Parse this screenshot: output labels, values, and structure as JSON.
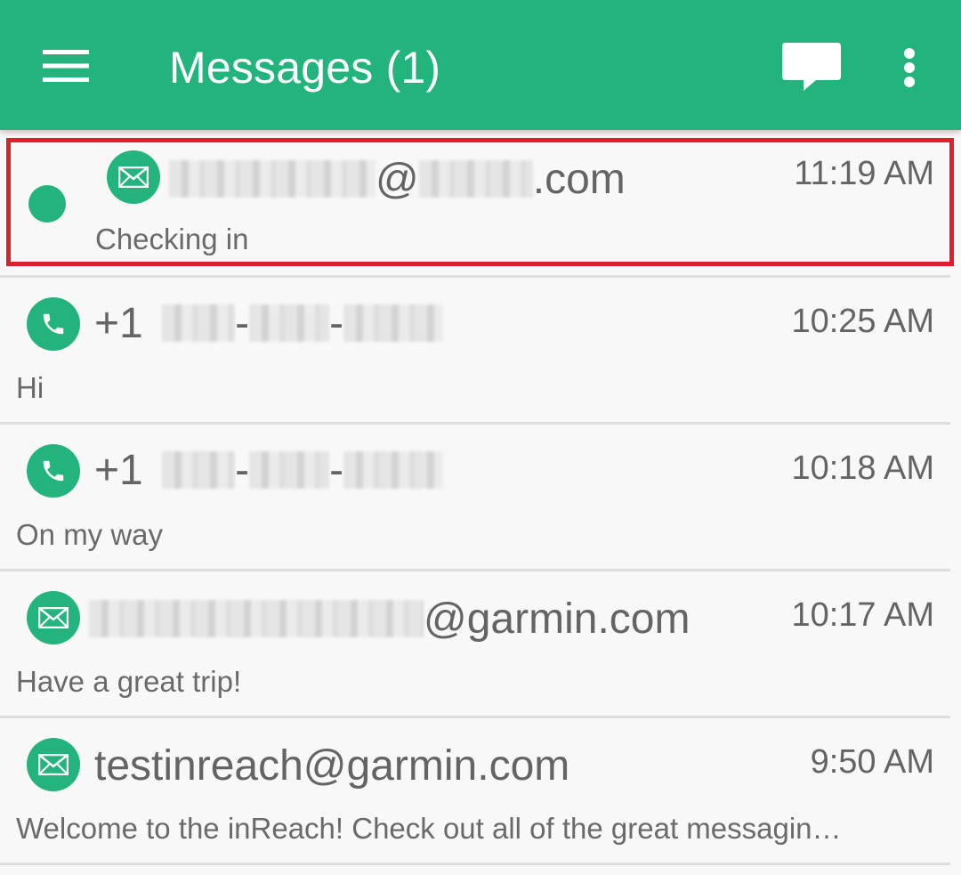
{
  "app_bar": {
    "title": "Messages (1)",
    "menu_icon": "hamburger-menu-icon",
    "compose_icon": "chat-bubble-icon",
    "overflow_icon": "more-vert-icon",
    "background_color": "#22b47c"
  },
  "messages": [
    {
      "type_icon": "email-icon",
      "sender_prefix": "",
      "sender_middle": "@",
      "sender_suffix": ".com",
      "time": "11:19 AM",
      "preview": "Checking in",
      "unread": true,
      "selected": true
    },
    {
      "type_icon": "phone-icon",
      "sender_prefix": "+1",
      "sender_middle": "-",
      "sender_middle2": "-",
      "time": "10:25 AM",
      "preview": "Hi",
      "unread": false
    },
    {
      "type_icon": "phone-icon",
      "sender_prefix": "+1",
      "sender_middle": "-",
      "sender_middle2": "-",
      "time": "10:18 AM",
      "preview": "On my way",
      "unread": false
    },
    {
      "type_icon": "email-icon",
      "sender_suffix": "@garmin.com",
      "time": "10:17 AM",
      "preview": "Have a great trip!",
      "unread": false
    },
    {
      "type_icon": "email-icon",
      "sender": "testinreach@garmin.com",
      "time": "9:50 AM",
      "preview": "Welcome to the inReach! Check out all of the great messagin…",
      "unread": false
    }
  ],
  "colors": {
    "accent": "#22b47c",
    "selection_border": "#e01f2b",
    "text": "#646464"
  }
}
